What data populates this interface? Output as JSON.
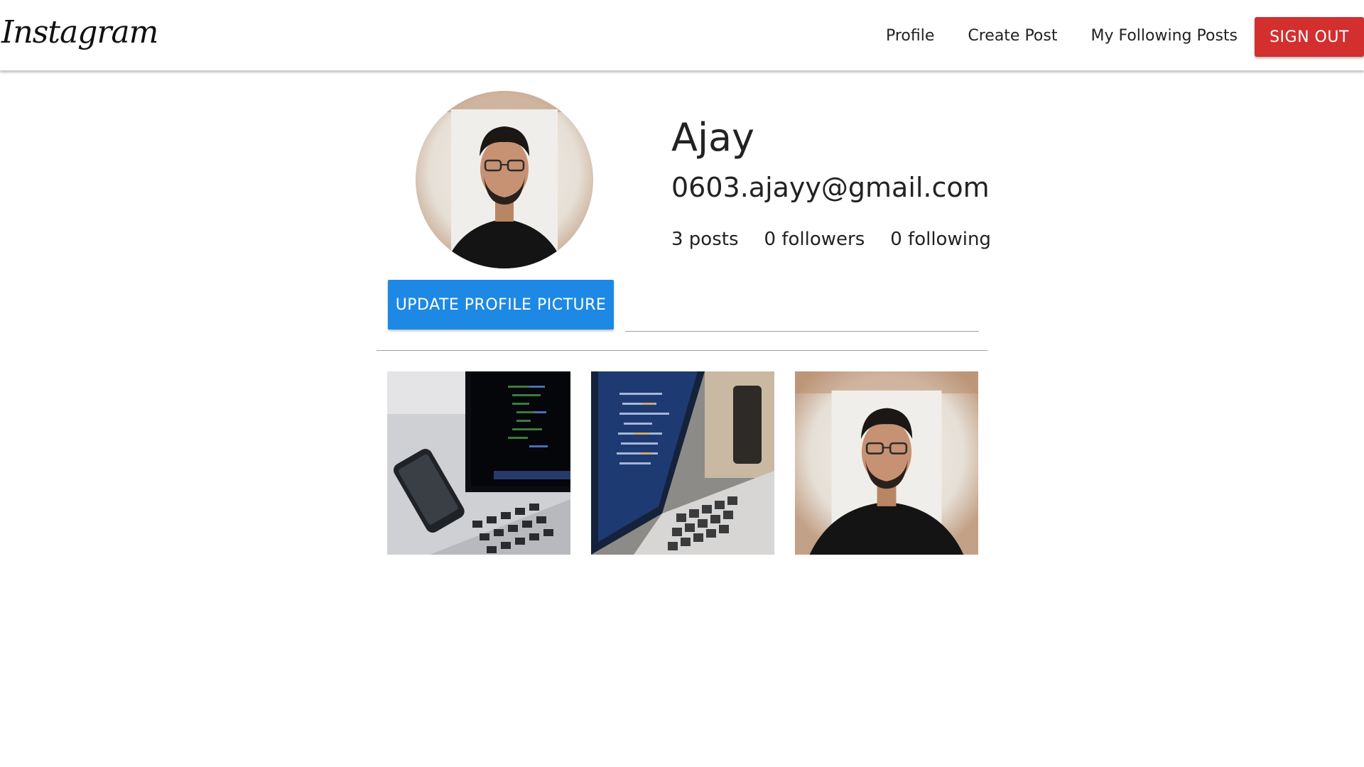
{
  "navbar": {
    "brand": "Instagram",
    "links": [
      "Profile",
      "Create Post",
      "My Following Posts"
    ],
    "signout_label": "SIGN OUT",
    "signout_color": "#d32f2f"
  },
  "profile": {
    "name": "Ajay",
    "email": "0603.ajayy@gmail.com",
    "stats": {
      "posts": "3 posts",
      "followers": "0 followers",
      "following": "0 following"
    },
    "update_picture_label": "UPDATE PROFILE PICTURE",
    "update_button_color": "#1e88e5",
    "avatar_icon": "profile-photo"
  },
  "posts": [
    {
      "icon": "laptop-code-photo"
    },
    {
      "icon": "laptop-screen-photo"
    },
    {
      "icon": "portrait-photo"
    }
  ]
}
